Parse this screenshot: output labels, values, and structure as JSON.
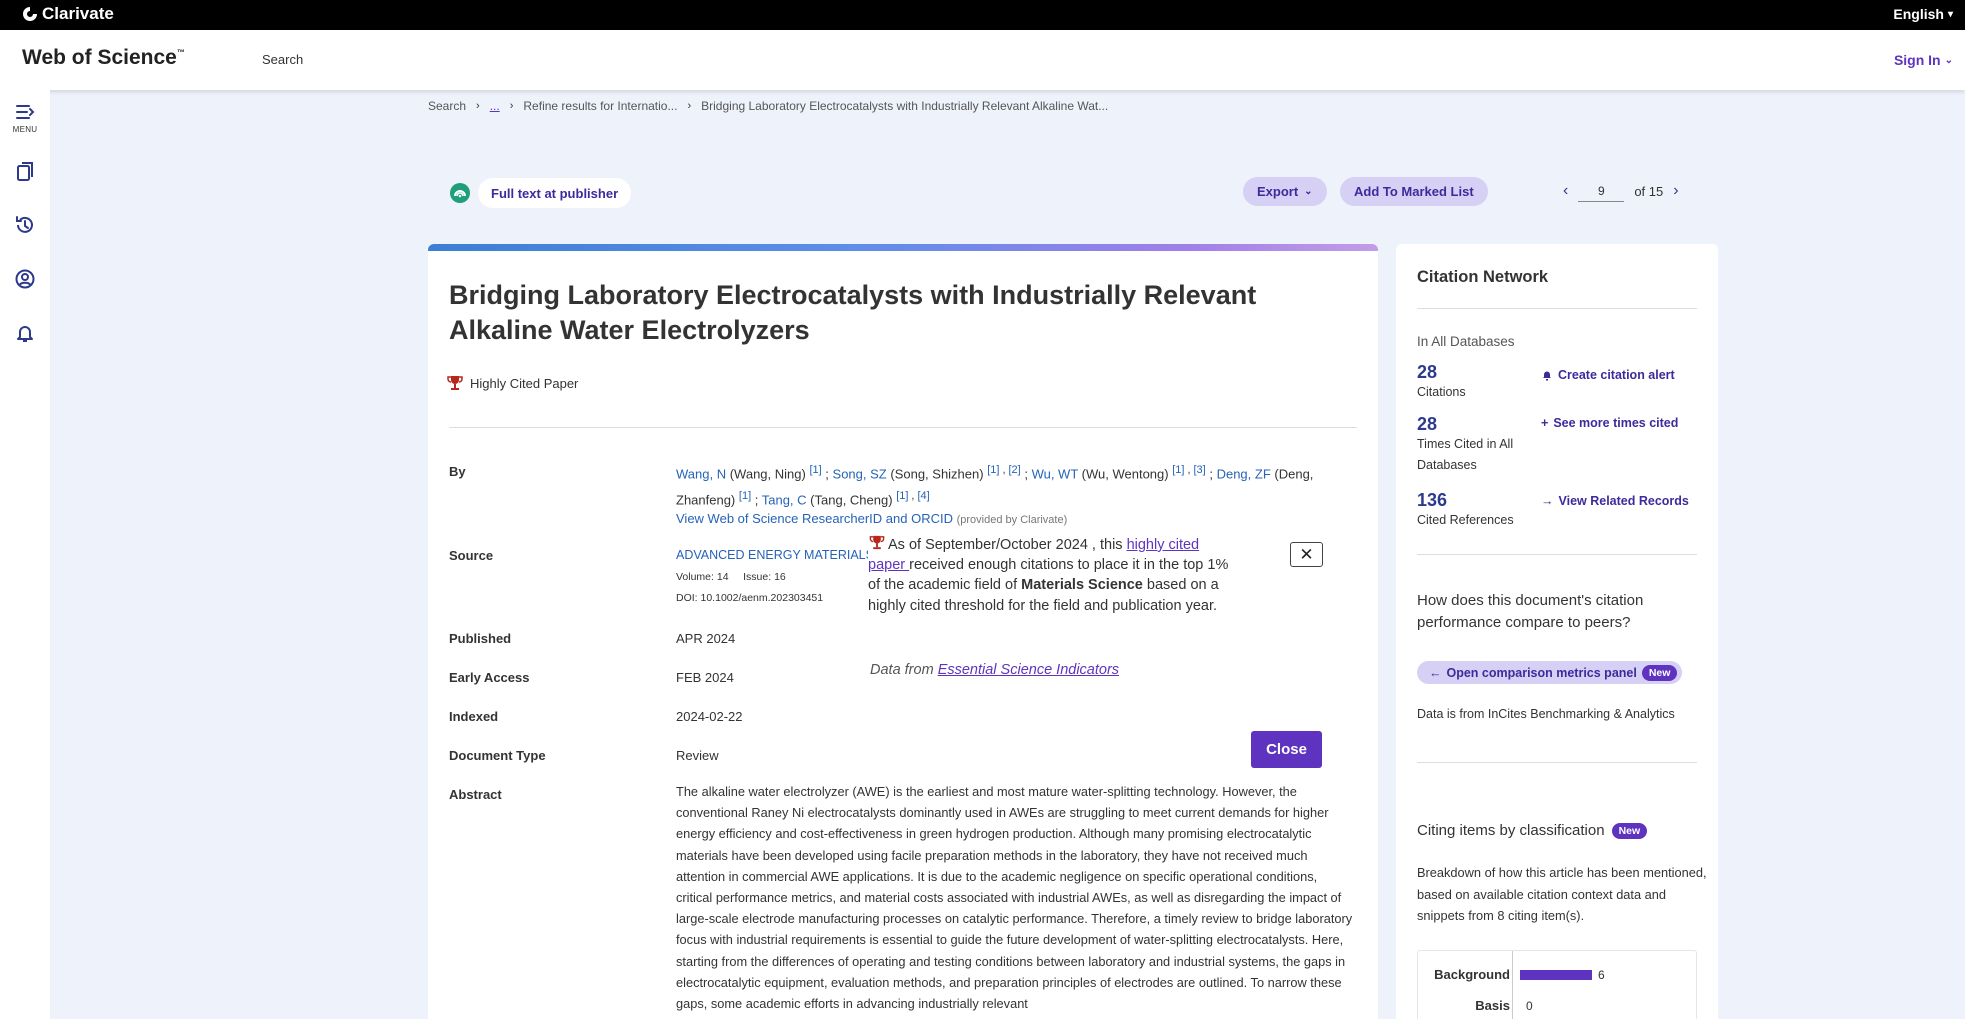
{
  "topbar": {
    "brand": "Clarivate",
    "language": "English"
  },
  "header": {
    "product": "Web of Science",
    "tm": "™",
    "nav_search": "Search",
    "sign_in": "Sign In"
  },
  "rail": {
    "menu_label": "MENU"
  },
  "breadcrumb": {
    "items": [
      "Search",
      "...",
      "Refine results for Internatio...",
      "Bridging Laboratory Electrocatalysts with Industrially Relevant Alkaline Wat..."
    ]
  },
  "toolbar": {
    "full_text": "Full text at publisher",
    "export": "Export",
    "add_marked": "Add To Marked List",
    "page_current": "9",
    "page_of": "of 15"
  },
  "record": {
    "title": "Bridging Laboratory Electrocatalysts with Industrially Relevant Alkaline Water Electrolyzers",
    "highly_cited": "Highly Cited Paper",
    "labels": {
      "by": "By",
      "source": "Source",
      "published": "Published",
      "early_access": "Early Access",
      "indexed": "Indexed",
      "doc_type": "Document Type",
      "abstract": "Abstract"
    },
    "authors": [
      {
        "short": "Wang, N",
        "full": "(Wang, Ning)",
        "affils": [
          "[1]"
        ]
      },
      {
        "short": "Song, SZ",
        "full": "(Song, Shizhen)",
        "affils": [
          "[1]",
          "[2]"
        ]
      },
      {
        "short": "Wu, WT",
        "full": "(Wu, Wentong)",
        "affils": [
          "[1]",
          "[3]"
        ]
      },
      {
        "short": "Deng, ZF",
        "full": "(Deng, Zhanfeng)",
        "affils": [
          "[1]"
        ]
      },
      {
        "short": "Tang, C",
        "full": "(Tang, Cheng)",
        "affils": [
          "[1]",
          "[4]"
        ]
      }
    ],
    "researcher_id_link": "View Web of Science ResearcherID and ORCID",
    "researcher_id_provider": "(provided by Clarivate)",
    "source_journal": "ADVANCED ENERGY MATERIALS",
    "volume": "Volume: 14",
    "issue": "Issue: 16",
    "doi": "DOI: 10.1002/aenm.202303451",
    "published": "APR 2024",
    "early_access": "FEB 2024",
    "indexed": "2024-02-22",
    "doc_type": "Review",
    "abstract": "The alkaline water electrolyzer (AWE) is the earliest and most mature water-splitting technology. However, the conventional Raney Ni electrocatalysts dominantly used in AWEs are struggling to meet current demands for higher energy efficiency and cost-effectiveness in green hydrogen production. Although many promising electrocatalytic materials have been developed using facile preparation methods in the laboratory, they have not received much attention in commercial AWE applications. It is due to the academic negligence on specific operational conditions, critical performance metrics, and material costs associated with industrial AWEs, as well as disregarding the impact of large-scale electrode manufacturing processes on catalytic performance. Therefore, a timely review to bridge laboratory focus with industrial requirements is essential to guide the future development of water-splitting electrocatalysts. Here, starting from the differences of operating and testing conditions between laboratory and industrial systems, the gaps in electrocatalytic equipment, evaluation methods, and preparation principles of electrodes are outlined. To narrow these gaps, some academic efforts in advancing industrially relevant"
  },
  "popover": {
    "lead": "As of September/October 2024 , this ",
    "link": "highly cited paper ",
    "mid": "received enough citations to place it in the top 1% of the academic field of ",
    "field": "Materials Science",
    "tail": " based on a highly cited threshold for the field and publication year.",
    "src_prefix": "Data from ",
    "src_link": "Essential Science Indicators",
    "x_label": "✕",
    "close": "Close"
  },
  "citation_network": {
    "heading": "Citation Network",
    "subheading": "In All Databases",
    "metrics": [
      {
        "value": "28",
        "label": "Citations"
      },
      {
        "value": "28",
        "label": "Times Cited in All Databases"
      },
      {
        "value": "136",
        "label": "Cited References"
      }
    ],
    "links": {
      "alert": "Create citation alert",
      "more_cited": "See more times cited",
      "related": "View Related Records"
    },
    "question": "How does this document's citation performance compare to peers?",
    "compare_pill": "Open comparison metrics panel",
    "new_badge": "New",
    "incites_note": "Data is from InCites Benchmarking & Analytics",
    "citing_heading": "Citing items by classification",
    "citing_desc": "Breakdown of how this article has been mentioned, based on available citation context data and snippets from 8 citing item(s).",
    "classes": [
      {
        "label": "Background",
        "value": 6
      },
      {
        "label": "Basis",
        "value": 0
      }
    ]
  },
  "colors": {
    "accent": "#5e33bf",
    "link": "#2563b8",
    "navy": "#2d3a8c",
    "pill": "#d6d0f5"
  }
}
